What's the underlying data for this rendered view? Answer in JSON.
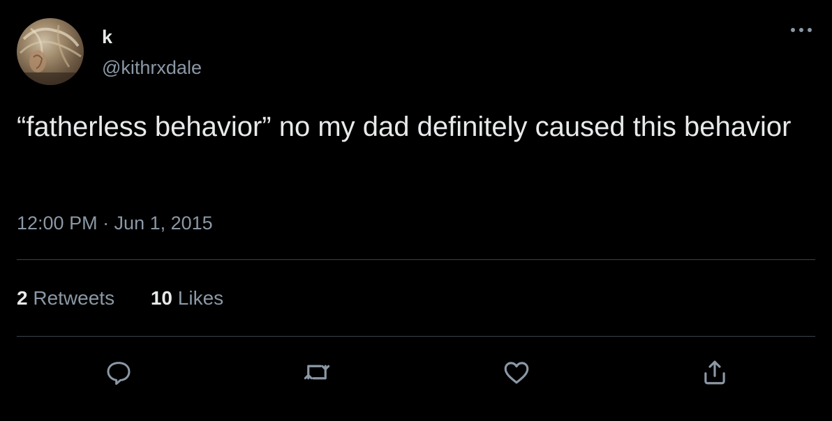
{
  "author": {
    "display_name": "k",
    "handle": "@kithrxdale",
    "avatar_icon": "profile-photo"
  },
  "tweet": {
    "text": "“fatherless behavior” no my dad definitely caused this behavior",
    "timestamp": "12:00 PM · Jun 1, 2015"
  },
  "stats": {
    "retweets_count": "2",
    "retweets_label": "Retweets",
    "likes_count": "10",
    "likes_label": "Likes"
  },
  "actions": {
    "reply_icon": "reply-icon",
    "retweet_icon": "retweet-icon",
    "like_icon": "heart-icon",
    "share_icon": "share-icon"
  },
  "colors": {
    "background": "#000000",
    "primary_text": "#e7e9ea",
    "secondary_text": "#8b98a5",
    "divider": "#38444d"
  }
}
